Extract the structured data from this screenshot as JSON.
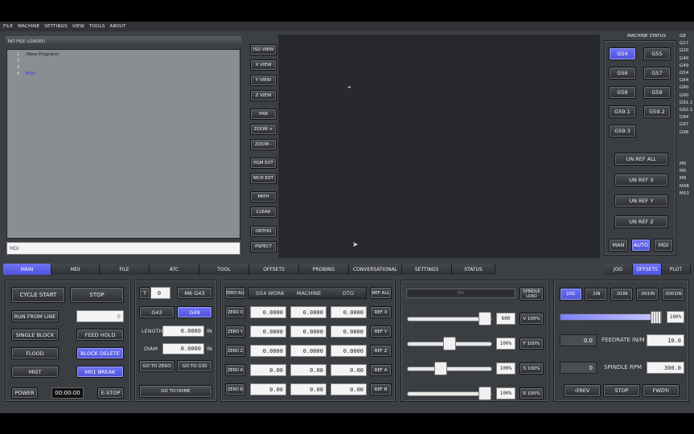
{
  "menu": [
    "FILE",
    "MACHINE",
    "SETTINGS",
    "VIEW",
    "TOOLS",
    "ABOUT"
  ],
  "editor": {
    "file_status": "NO FILE LOADED",
    "lines": [
      {
        "n": "1",
        "t": "(New Program)"
      },
      {
        "n": "2",
        "t": ""
      },
      {
        "n": "3",
        "t": ""
      },
      {
        "n": "4",
        "t": "M30"
      }
    ],
    "mdi_placeholder": "MDI"
  },
  "view_buttons": [
    "ISO VIEW",
    "X VIEW",
    "Y VIEW",
    "Z VIEW",
    "PAN",
    "ZOOM +",
    "ZOOM -",
    "PGM EXT",
    "MCH EXT",
    "PATH",
    "CLEAR",
    "ORTHO",
    "PSPECT"
  ],
  "status": {
    "title": "MACHINE STATUS",
    "wcs": [
      "G54",
      "G55",
      "G56",
      "G57",
      "G58",
      "G59",
      "G59.1",
      "G59.2",
      "G59.3"
    ],
    "active_wcs": "G54",
    "unref": [
      "UN REF ALL",
      "UN REF X",
      "UN REF Y",
      "UN REF Z"
    ],
    "modes": [
      "MAN",
      "AUTO",
      "MDI"
    ],
    "active_mode": "AUTO",
    "gcodes": [
      "G8",
      "G17",
      "G20",
      "G40",
      "G49",
      "G54",
      "G64",
      "G80",
      "G90",
      "G91.1",
      "G92.1",
      "G94",
      "G97",
      "G98"
    ],
    "mcodes": [
      "M0",
      "M5",
      "M9",
      "M48",
      "M53"
    ]
  },
  "main_tabs": [
    "MAIN",
    "MDI",
    "FILE",
    "ATC",
    "TOOL",
    "OFFSETS",
    "PROBING",
    "CONVERSATIONAL",
    "SETTINGS",
    "STATUS"
  ],
  "active_main_tab": "MAIN",
  "right_tabs": [
    "JOG",
    "OFFSETS",
    "PLOT"
  ],
  "active_right_tab": "OFFSETS",
  "control": {
    "cycle_start": "CYCLE START",
    "stop": "STOP",
    "run_from_line": "RUN FROM LINE",
    "run_line_value": "0",
    "single_block": "SINGLE BLOCK",
    "feed_hold": "FEED HOLD",
    "flood": "FLOOD",
    "block_delete": "BLOCK DELETE",
    "mist": "MIST",
    "m01_break": "M01 BREAK",
    "power": "POWER",
    "timer": "00:00:00",
    "estop": "E-STOP"
  },
  "tool": {
    "t_label": "T",
    "t_value": "0",
    "m6g43": "M6 G43",
    "g43": "G43",
    "g49": "G49",
    "length_label": "LENGTH",
    "length_value": "0.0000",
    "length_unit": "IN",
    "diam_label": "DIAM",
    "diam_value": "0.0000",
    "diam_unit": "IN",
    "goto_zero": "GO TO ZERO",
    "goto_g30": "GO TO G30",
    "goto_home": "GO TO HOME"
  },
  "dro": {
    "zero_all": "ZERO ALL",
    "h_work": "G54 WORK",
    "h_machine": "MACHINE",
    "h_dtg": "DTG",
    "ref_all": "REF ALL",
    "axes": [
      {
        "zero": "ZERO X",
        "work": "0.0000",
        "machine": "0.0000",
        "dtg": "0.0000",
        "ref": "REF X"
      },
      {
        "zero": "ZERO Y",
        "work": "0.0000",
        "machine": "0.0000",
        "dtg": "0.0000",
        "ref": "REF Y"
      },
      {
        "zero": "ZERO Z",
        "work": "0.0000",
        "machine": "0.0000",
        "dtg": "0.0000",
        "ref": "REF Z"
      },
      {
        "zero": "ZERO A",
        "work": "0.00",
        "machine": "0.00",
        "dtg": "0.00",
        "ref": "REF A"
      },
      {
        "zero": "ZERO B",
        "work": "0.00",
        "machine": "0.00",
        "dtg": "0.00",
        "ref": "REF B"
      }
    ]
  },
  "overrides": {
    "spindle_load_pct": "0%",
    "spindle_load_label": "SPINDLE LOAD",
    "rows": [
      {
        "value": "600",
        "btn": "V 100%",
        "pos": 1.0
      },
      {
        "value": "100%",
        "btn": "F 100%",
        "pos": 0.5
      },
      {
        "value": "100%",
        "btn": "S 100%",
        "pos": 0.37
      },
      {
        "value": "100%",
        "btn": "R 100%",
        "pos": 1.0
      }
    ]
  },
  "jog": {
    "steps": [
      "JOG",
      ".1IN",
      ".01IN",
      ".001IN",
      ".0001IN"
    ],
    "active_step": "JOG",
    "jog_pct": "100%",
    "feed_value": "0.0",
    "feed_label": "FEEDRATE IN/M",
    "feed_set": "10.0",
    "spindle_value": "0",
    "spindle_label": "SPINDLE RPM",
    "spindle_set": "300.0",
    "rev": "REV",
    "stop": "STOP",
    "fwd": "FWD"
  }
}
